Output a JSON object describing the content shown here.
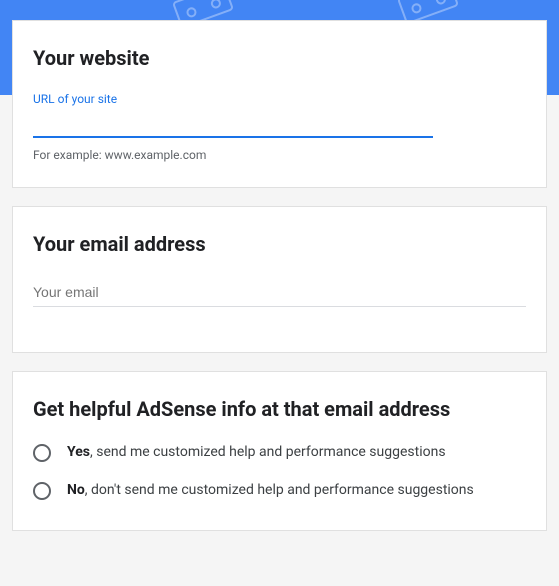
{
  "website": {
    "title": "Your website",
    "field_label": "URL of your site",
    "value": "",
    "helper": "For example: www.example.com"
  },
  "email": {
    "title": "Your email address",
    "placeholder": "Your email",
    "value": ""
  },
  "consent": {
    "title": "Get helpful AdSense info at that email address",
    "options": {
      "yes_prefix": "Yes",
      "yes_text": ", send me customized help and performance suggestions",
      "no_prefix": "No",
      "no_text": ", don't send me customized help and performance suggestions"
    }
  }
}
